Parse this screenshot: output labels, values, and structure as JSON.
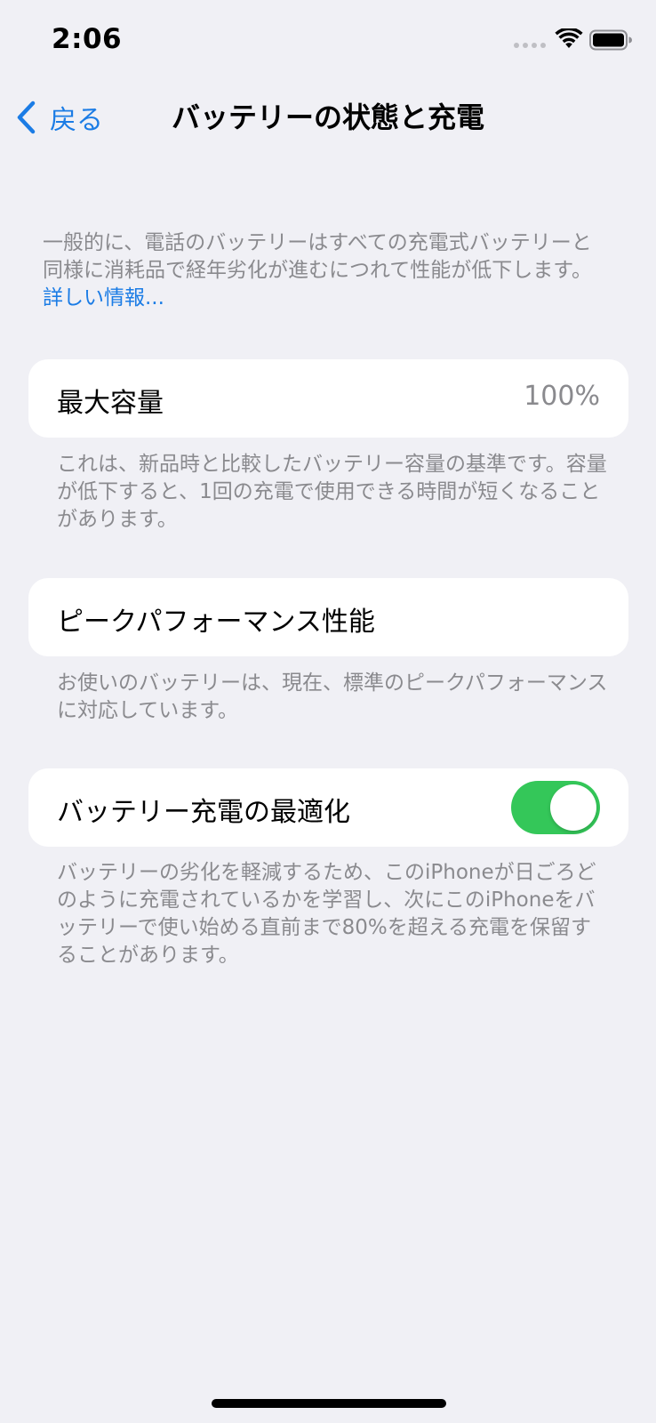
{
  "status_bar": {
    "time": "2:06"
  },
  "nav": {
    "back_label": "戻る",
    "title": "バッテリーの状態と充電"
  },
  "intro": {
    "text": "一般的に、電話のバッテリーはすべての充電式バッテリーと同様に消耗品で経年劣化が進むにつれて性能が低下します。",
    "link": "詳しい情報..."
  },
  "max_capacity": {
    "label": "最大容量",
    "value": "100%",
    "footnote": "これは、新品時と比較したバッテリー容量の基準です。容量が低下すると、1回の充電で使用できる時間が短くなることがあります。"
  },
  "peak_performance": {
    "label": "ピークパフォーマンス性能",
    "footnote": "お使いのバッテリーは、現在、標準のピークパフォーマンスに対応しています。"
  },
  "optimized_charging": {
    "label": "バッテリー充電の最適化",
    "enabled": true,
    "footnote": "バッテリーの劣化を軽減するため、このiPhoneが日ごろどのように充電されているかを学習し、次にこのiPhoneをバッテリーで使い始める直前まで80%を超える充電を保留することがあります。"
  },
  "colors": {
    "background": "#f0f0f5",
    "accent": "#1b7ce5",
    "toggle_on": "#34c759",
    "secondary_text": "#8a8a8e"
  },
  "icons": {
    "back": "chevron-left-icon",
    "wifi": "wifi-icon",
    "battery": "battery-icon",
    "signal": "cellular-signal-icon"
  }
}
